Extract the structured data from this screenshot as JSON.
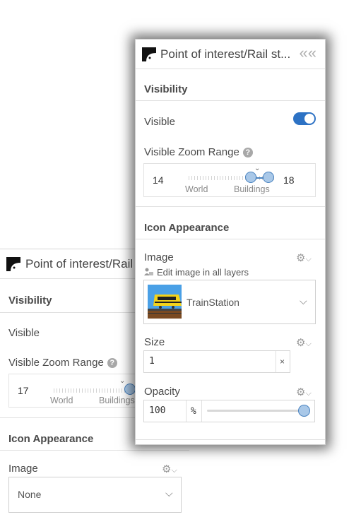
{
  "back_panel": {
    "title": "Point of interest/Rail st...",
    "visibility": {
      "section_title": "Visibility",
      "visible_label": "Visible",
      "zoom_label": "Visible Zoom Range",
      "min_zoom": "17",
      "scale_world": "World",
      "scale_buildings": "Buildings"
    },
    "icon_appearance": {
      "section_title": "Icon Appearance",
      "image_label": "Image",
      "image_value": "None"
    }
  },
  "front_panel": {
    "title": "Point of interest/Rail st...",
    "visibility": {
      "section_title": "Visibility",
      "visible_label": "Visible",
      "visible_on": true,
      "zoom_label": "Visible Zoom Range",
      "min_zoom": "14",
      "max_zoom": "18",
      "scale_world": "World",
      "scale_buildings": "Buildings"
    },
    "icon_appearance": {
      "section_title": "Icon Appearance",
      "image_label": "Image",
      "edit_all_label": "Edit image in all layers",
      "image_value": "TrainStation",
      "size_label": "Size",
      "size_value": "1",
      "opacity_label": "Opacity",
      "opacity_value": "100",
      "opacity_unit": "%"
    }
  },
  "icons": {
    "help": "?",
    "clear": "×",
    "collapse": "«",
    "chevron": "⌵",
    "gear": "⚙"
  },
  "colors": {
    "accent": "#2d72c4",
    "handle_fill": "#a9c8e8"
  }
}
